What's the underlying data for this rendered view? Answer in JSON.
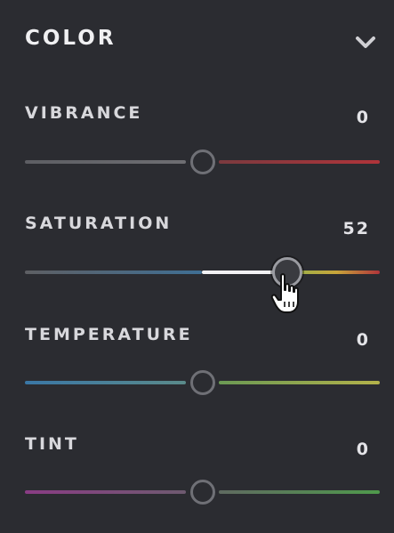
{
  "panel": {
    "title": "COLOR",
    "collapse_icon": "chevron-down-icon"
  },
  "sliders": [
    {
      "id": "vibrance",
      "label": "VIBRANCE",
      "value": "0",
      "numeric": 0,
      "min": -100,
      "max": 100,
      "left_color": "#6e6e72",
      "right_color": "#b0343a"
    },
    {
      "id": "saturation",
      "label": "SATURATION",
      "value": "52",
      "numeric": 52,
      "min": -100,
      "max": 100,
      "left_color": "#3f6f94",
      "right_color": "#b0343a"
    },
    {
      "id": "temperature",
      "label": "TEMPERATURE",
      "value": "0",
      "numeric": 0,
      "min": -100,
      "max": 100,
      "left_color": "#3a77a6",
      "right_color": "#b3b24a"
    },
    {
      "id": "tint",
      "label": "TINT",
      "value": "0",
      "numeric": 0,
      "min": -100,
      "max": 100,
      "left_color": "#8a3c84",
      "right_color": "#4f9a4c"
    }
  ],
  "colors": {
    "background": "#2b2c31",
    "text": "#d8d8dc"
  },
  "cursor": "hand-pointer-icon"
}
